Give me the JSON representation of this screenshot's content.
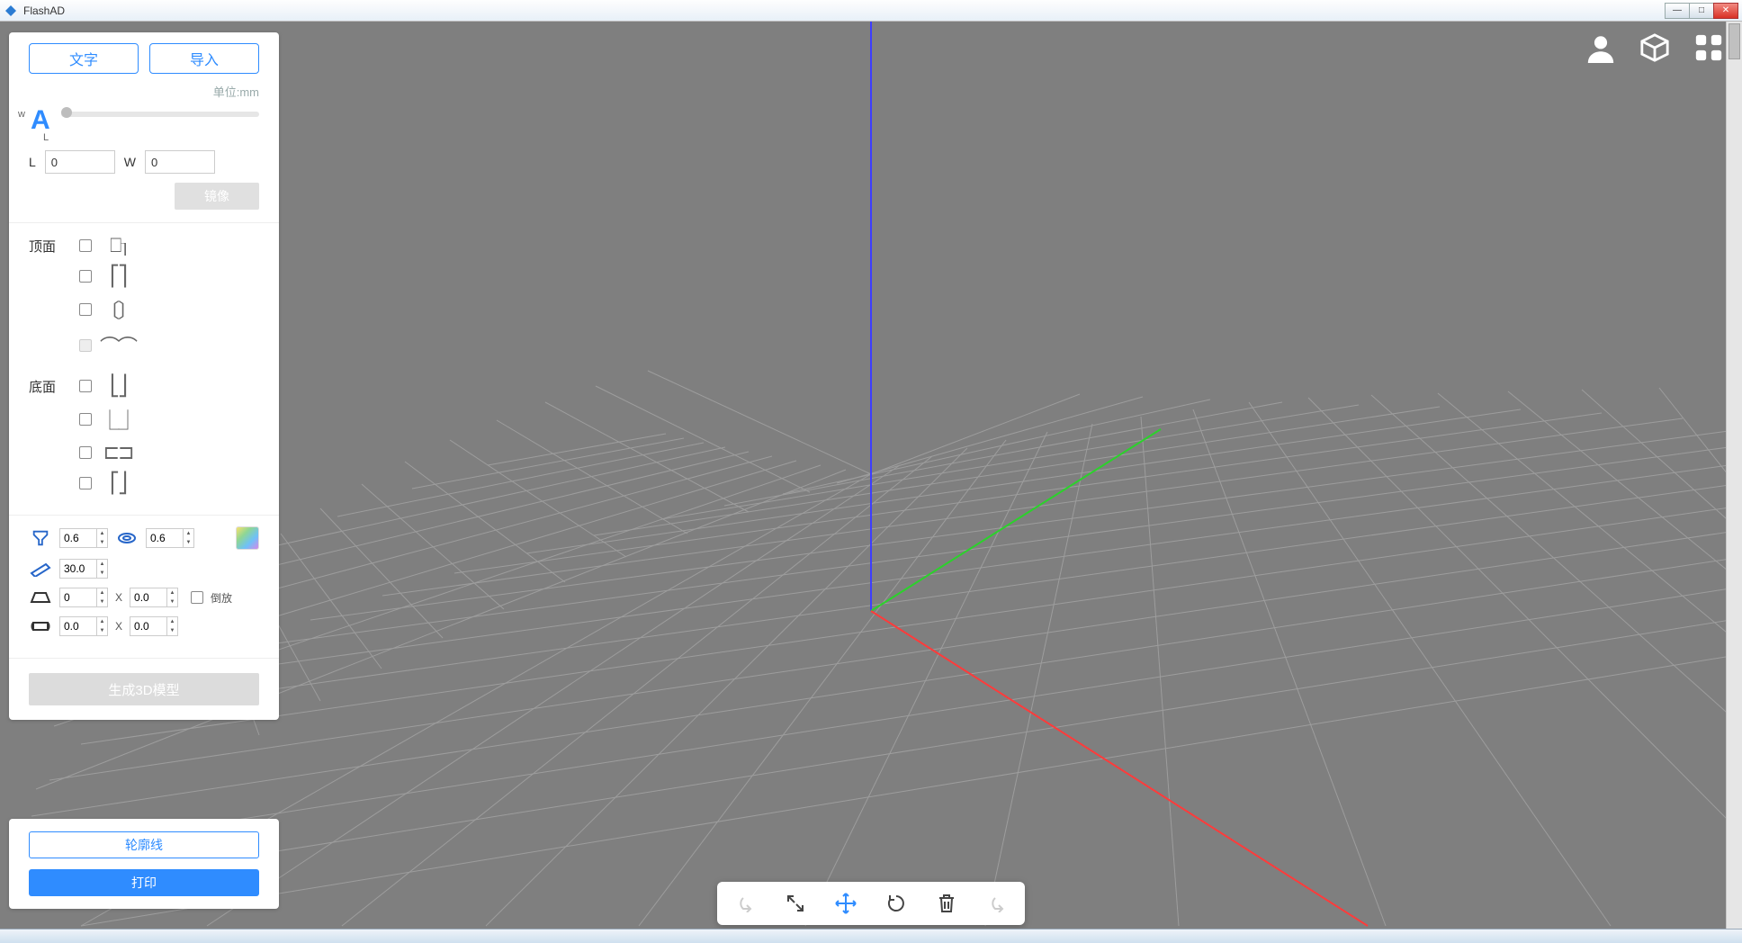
{
  "app": {
    "title": "FlashAD"
  },
  "sidebar": {
    "tabs": {
      "text": "文字",
      "import": "导入"
    },
    "unit_label": "单位:mm",
    "dims": {
      "l_label": "L",
      "w_label": "W",
      "l_value": "0",
      "w_value": "0"
    },
    "mirror_label": "镜像",
    "top_face_label": "顶面",
    "bottom_face_label": "底面",
    "params": {
      "nozzle": "0.6",
      "ring": "0.6",
      "thickness": "30.0",
      "trapezoid_a": "0",
      "trapezoid_b": "0.0",
      "bulge_a": "0.0",
      "bulge_b": "0.0",
      "flip_label": "倒放"
    },
    "generate_label": "生成3D模型"
  },
  "lowercard": {
    "outline_label": "轮廓线",
    "print_label": "打印"
  },
  "float_toolbar": {
    "undo": "undo",
    "expand": "expand",
    "move": "move",
    "rotate": "rotate",
    "delete": "delete",
    "redo": "redo"
  }
}
